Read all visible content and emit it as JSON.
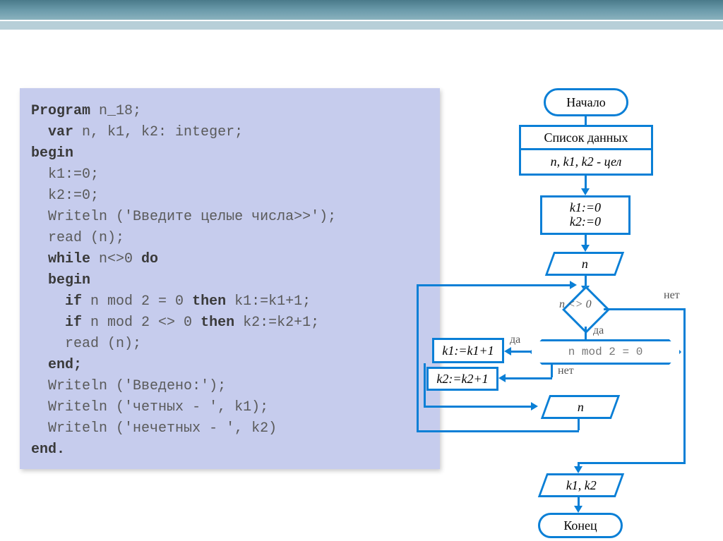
{
  "code": {
    "l1a": "Program",
    "l1b": " n_18;",
    "l2a": "var",
    "l2b": " n, k1, k2: integer;",
    "l3": "begin",
    "l4": "k1:=0;",
    "l5": "k2:=0;",
    "l6a": "Writeln (",
    "l6b": "'Введите целые числа>>'",
    "l6c": ");",
    "l7": "read (n);",
    "l8a": "while",
    "l8b": " n<>0 ",
    "l8c": "do",
    "l9": "begin",
    "l10a": "if",
    "l10b": " n mod 2 = 0 ",
    "l10c": "then",
    "l10d": " k1:=k1+1;",
    "l11a": "if",
    "l11b": " n mod 2 <> 0 ",
    "l11c": "then",
    "l11d": " k2:=k2+1;",
    "l12": "read (n);",
    "l13": "end;",
    "l14a": "Writeln (",
    "l14b": "'Введено:'",
    "l14c": ");",
    "l15a": "Writeln (",
    "l15b": "'четных - '",
    "l15c": ", k1);",
    "l16a": "Writeln (",
    "l16b": "'нечетных - '",
    "l16c": ", k2)",
    "l17": "end."
  },
  "flow": {
    "start": "Начало",
    "datalist": "Список данных",
    "vars": "n, k1, k2 - цел",
    "init1": "k1:=0",
    "init2": "k2:=0",
    "in_n": "n",
    "cond1": "n <> 0",
    "cond2": "n mod 2 = 0",
    "k1inc": "k1:=k1+1",
    "k2inc": "k2:=k2+1",
    "in_n2": "n",
    "out": "k1, k2",
    "end": "Конец",
    "yes": "да",
    "no": "нет"
  }
}
